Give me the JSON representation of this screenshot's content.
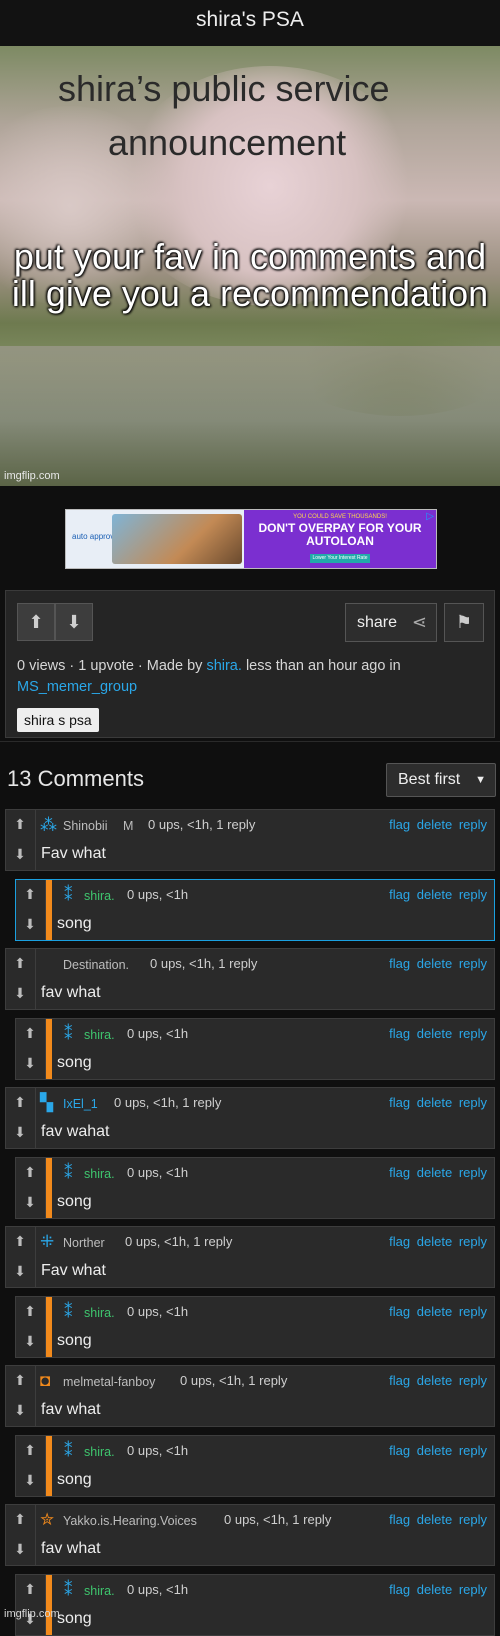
{
  "header": {
    "title": "shira's PSA"
  },
  "meme": {
    "line1": "shira’s public service",
    "line2": "announcement",
    "body": "put your fav in comments and ill give you a recommendation",
    "watermark": "imgflip.com"
  },
  "ad": {
    "brand": "auto approve",
    "small": "YOU COULD SAVE THOUSANDS!",
    "headline": "DON'T OVERPAY FOR YOUR AUTOLOAN",
    "cta": "Lower Your Interest Rate"
  },
  "post": {
    "share_label": "share",
    "views": "0 views",
    "upvotes": "1 upvote",
    "made_by_prefix": "Made by",
    "author": "shira.",
    "time": "less than an hour ago in",
    "stream": "MS_memer_group",
    "tag": "shira s psa"
  },
  "comments_header": {
    "count": "13 Comments",
    "sort": "Best first"
  },
  "actions": {
    "flag": "flag",
    "delete": "delete",
    "reply": "reply"
  },
  "comments": [
    {
      "user": "Shinobii",
      "suffix": "M",
      "info": "0 ups, <1h, 1 reply",
      "text": "Fav what",
      "user_color": "#bdbdbd",
      "avatar": "⁂"
    },
    {
      "user": "shira.",
      "suffix": "",
      "info": "0 ups, <1h",
      "text": "song",
      "user_color": "#3ec46d",
      "avatar": "⁑"
    },
    {
      "user": "Destination.",
      "suffix": "",
      "info": "0 ups, <1h, 1 reply",
      "text": "fav what",
      "user_color": "#bdbdbd",
      "avatar": ""
    },
    {
      "user": "shira.",
      "suffix": "",
      "info": "0 ups, <1h",
      "text": "song",
      "user_color": "#3ec46d",
      "avatar": "⁑"
    },
    {
      "user": "IxEl_1",
      "suffix": "",
      "info": "0 ups, <1h, 1 reply",
      "text": "fav wahat",
      "user_color": "#2aa7e8",
      "avatar": "▚"
    },
    {
      "user": "shira.",
      "suffix": "",
      "info": "0 ups, <1h",
      "text": "song",
      "user_color": "#3ec46d",
      "avatar": "⁑"
    },
    {
      "user": "Norther",
      "suffix": "",
      "info": "0 ups, <1h, 1 reply",
      "text": "Fav what",
      "user_color": "#bdbdbd",
      "avatar": "⁜"
    },
    {
      "user": "shira.",
      "suffix": "",
      "info": "0 ups, <1h",
      "text": "song",
      "user_color": "#3ec46d",
      "avatar": "⁑"
    },
    {
      "user": "melmetal-fanboy",
      "suffix": "",
      "info": "0 ups, <1h, 1 reply",
      "text": "fav what",
      "user_color": "#bdbdbd",
      "avatar": "◘"
    },
    {
      "user": "shira.",
      "suffix": "",
      "info": "0 ups, <1h",
      "text": "song",
      "user_color": "#3ec46d",
      "avatar": "⁑"
    },
    {
      "user": "Yakko.is.Hearing.Voices",
      "suffix": "",
      "info": "0 ups, <1h, 1 reply",
      "text": "fav what",
      "user_color": "#bdbdbd",
      "avatar": "✮"
    },
    {
      "user": "shira.",
      "suffix": "",
      "info": "0 ups, <1h",
      "text": "song",
      "user_color": "#3ec46d",
      "avatar": "⁑"
    }
  ],
  "footer": {
    "watermark": "imgflip.com"
  },
  "colors": {
    "accent": "#2aa7e8",
    "reply_bar": "#f28a1c",
    "author_green": "#3ec46d"
  }
}
